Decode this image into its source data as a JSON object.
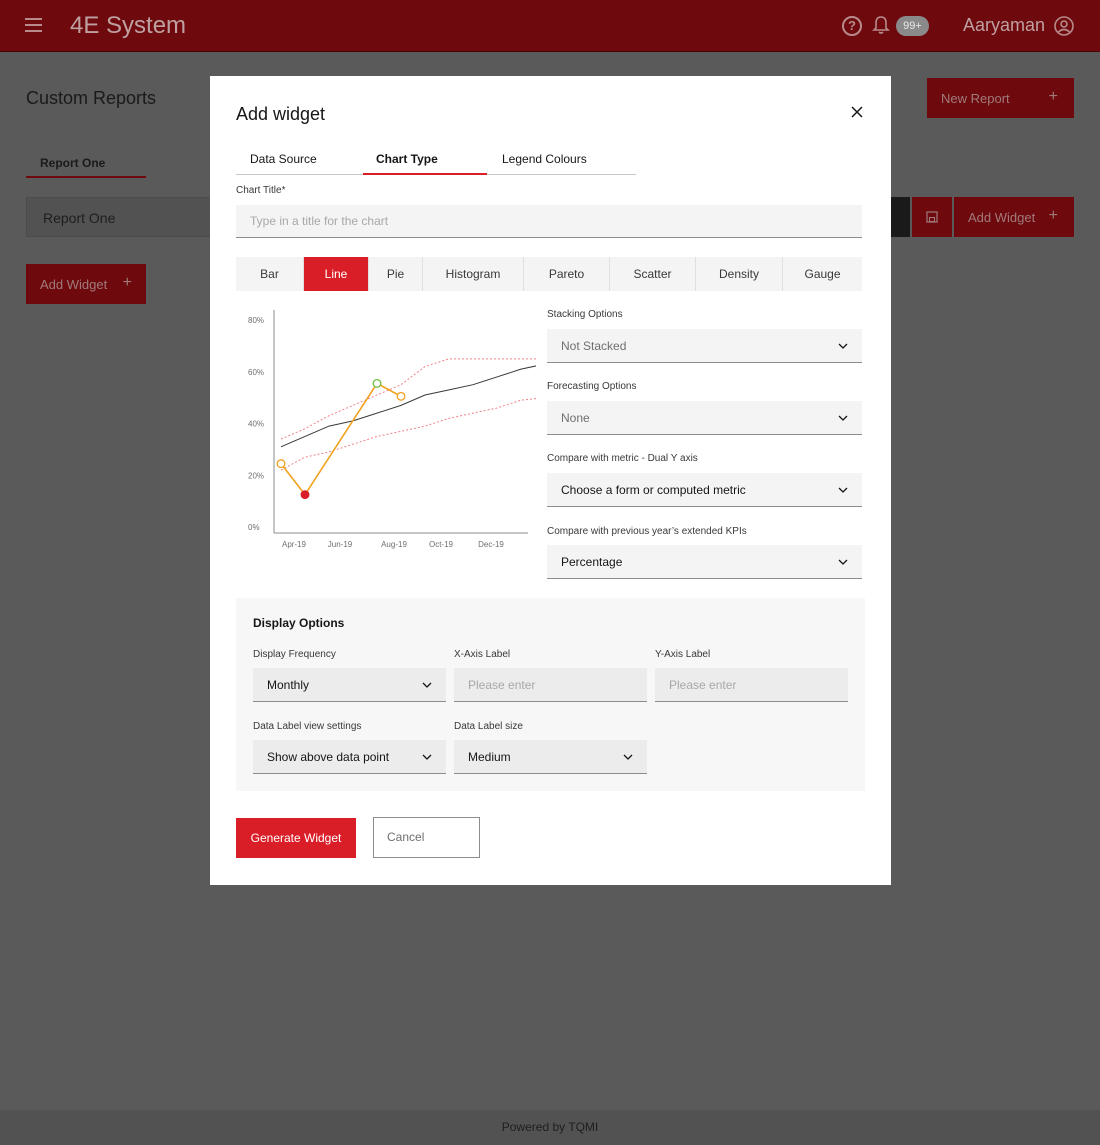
{
  "header": {
    "app_title": "4E System",
    "notification_count": "99+",
    "user_name": "Aaryaman"
  },
  "page": {
    "title": "Custom Reports",
    "new_report_label": "New Report",
    "report_tab": "Report One",
    "report_row": "Report One",
    "add_widget_top": "Add Widget",
    "add_widget_left": "Add Widget"
  },
  "modal": {
    "title": "Add widget",
    "tabs": [
      "Data Source",
      "Chart Type",
      "Legend Colours"
    ],
    "active_tab": "Chart Type",
    "chart_title_label": "Chart Title*",
    "chart_title_placeholder": "Type in a title for the chart",
    "chart_types": [
      "Bar",
      "Line",
      "Pie",
      "Histogram",
      "Pareto",
      "Scatter",
      "Density",
      "Gauge"
    ],
    "active_chart_type": "Line",
    "stacking_label": "Stacking Options",
    "stacking_value": "Not Stacked",
    "forecasting_label": "Forecasting Options",
    "forecasting_value": "None",
    "compare_metric_label": "Compare with metric - Dual Y axis",
    "compare_metric_value": "Choose a form or computed metric",
    "compare_kpi_label": "Compare with previous year’s extended KPIs",
    "compare_kpi_value": "Percentage",
    "display_options_title": "Display Options",
    "display_frequency_label": "Display Frequency",
    "display_frequency_value": "Monthly",
    "x_axis_label": "X-Axis Label",
    "x_axis_placeholder": "Please enter",
    "y_axis_label": "Y-Axis Label",
    "y_axis_placeholder": "Please enter",
    "data_label_view_label": "Data Label view settings",
    "data_label_view_value": "Show above data point",
    "data_label_size_label": "Data Label size",
    "data_label_size_value": "Medium",
    "generate_label": "Generate Widget",
    "cancel_label": "Cancel"
  },
  "chart_data": {
    "type": "line",
    "y_ticks": [
      "80%",
      "60%",
      "40%",
      "20%",
      "0%"
    ],
    "x_ticks": [
      "Apr-19",
      "Jun-19",
      "Aug-19",
      "Oct-19",
      "Dec-19"
    ],
    "ylim": [
      0,
      80
    ],
    "xlim": [
      0,
      10
    ],
    "series": [
      {
        "role": "trend",
        "color": "#393939",
        "style": "solid",
        "points": [
          [
            0,
            31
          ],
          [
            1,
            35
          ],
          [
            2,
            39
          ],
          [
            3,
            41
          ],
          [
            4,
            44
          ],
          [
            5,
            47
          ],
          [
            6,
            51
          ],
          [
            7,
            53
          ],
          [
            8,
            55
          ],
          [
            9,
            58
          ],
          [
            10,
            61
          ],
          [
            11,
            63
          ]
        ]
      },
      {
        "role": "upper-band",
        "color": "#f08088",
        "style": "dotted",
        "points": [
          [
            0,
            34
          ],
          [
            1,
            38
          ],
          [
            2,
            43
          ],
          [
            3,
            47
          ],
          [
            4,
            51
          ],
          [
            5,
            55
          ],
          [
            6,
            62
          ],
          [
            7,
            65
          ],
          [
            8,
            65
          ],
          [
            9,
            65
          ],
          [
            10,
            65
          ],
          [
            11,
            65
          ]
        ]
      },
      {
        "role": "lower-band",
        "color": "#f08088",
        "style": "dotted",
        "points": [
          [
            0,
            22
          ],
          [
            1,
            27
          ],
          [
            2,
            29
          ],
          [
            3,
            32
          ],
          [
            4,
            35
          ],
          [
            5,
            37
          ],
          [
            6,
            39
          ],
          [
            7,
            42
          ],
          [
            8,
            44
          ],
          [
            9,
            46
          ],
          [
            10,
            49
          ],
          [
            11,
            50
          ]
        ]
      },
      {
        "role": "highlight",
        "color": "#f1a11d",
        "style": "solid",
        "points": [
          [
            0,
            24.5
          ],
          [
            1,
            12.5
          ],
          [
            4,
            55.5
          ],
          [
            5,
            50.5
          ]
        ]
      }
    ],
    "markers": [
      {
        "x": 0,
        "y": 24.5,
        "color": "#f1a11d",
        "fill": "#ffffff"
      },
      {
        "x": 1,
        "y": 12.5,
        "color": "#da1e28",
        "fill": "#da1e28"
      },
      {
        "x": 4,
        "y": 55.5,
        "color": "#6fbb3a",
        "fill": "#ffffff"
      },
      {
        "x": 5,
        "y": 50.5,
        "color": "#f1a11d",
        "fill": "#ffffff"
      }
    ]
  },
  "colors": {
    "accent": "#da1e28",
    "header_bg": "#6e0a0e"
  }
}
